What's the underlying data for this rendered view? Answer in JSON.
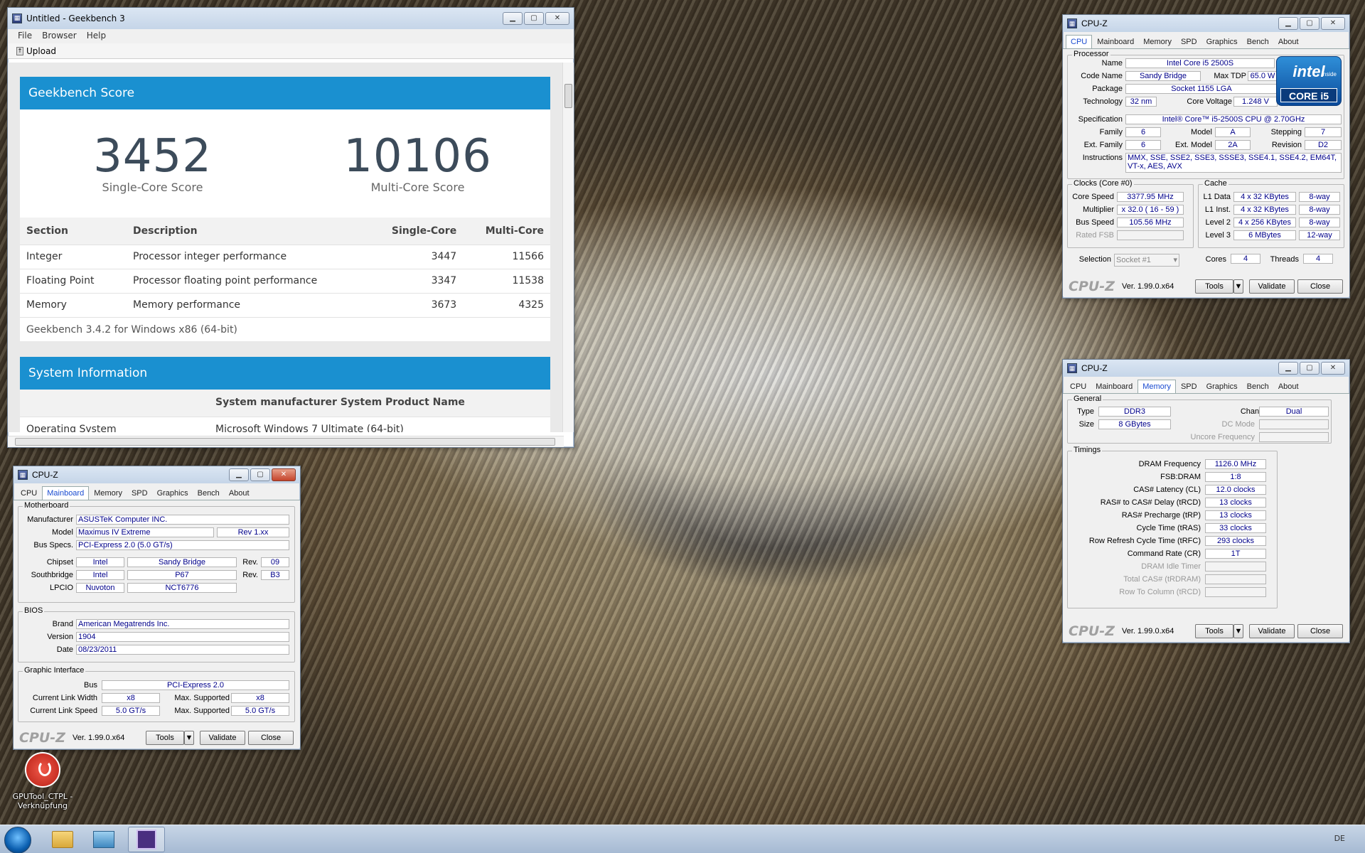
{
  "geekbench": {
    "title": "Untitled - Geekbench 3",
    "menu": [
      "File",
      "Browser",
      "Help"
    ],
    "toolbar_upload": "Upload",
    "score_header": "Geekbench Score",
    "single_score": "3452",
    "single_label": "Single-Core Score",
    "multi_score": "10106",
    "multi_label": "Multi-Core Score",
    "columns": [
      "Section",
      "Description",
      "Single-Core",
      "Multi-Core"
    ],
    "rows": [
      [
        "Integer",
        "Processor integer performance",
        "3447",
        "11566"
      ],
      [
        "Floating Point",
        "Processor floating point performance",
        "3347",
        "11538"
      ],
      [
        "Memory",
        "Memory performance",
        "3673",
        "4325"
      ]
    ],
    "footer": "Geekbench 3.4.2 for Windows x86 (64-bit)",
    "sysinfo_header": "System Information",
    "sysinfo_col": "System manufacturer System Product Name",
    "sysinfo_row": [
      "Operating System",
      "Microsoft Windows 7 Ultimate (64-bit)"
    ]
  },
  "cpuz_common": {
    "title": "CPU-Z",
    "tabs": [
      "CPU",
      "Mainboard",
      "Memory",
      "SPD",
      "Graphics",
      "Bench",
      "About"
    ],
    "logo": "CPU-Z",
    "version": "Ver. 1.99.0.x64",
    "tools": "Tools",
    "validate": "Validate",
    "close": "Close",
    "tools_arrow": "▼"
  },
  "cpuz_cpu": {
    "group_processor": "Processor",
    "name_l": "Name",
    "name": "Intel Core i5 2500S",
    "codename_l": "Code Name",
    "codename": "Sandy Bridge",
    "maxtdp_l": "Max TDP",
    "maxtdp": "65.0 W",
    "package_l": "Package",
    "package": "Socket 1155 LGA",
    "tech_l": "Technology",
    "tech": "32 nm",
    "cvolt_l": "Core Voltage",
    "cvolt": "1.248 V",
    "spec_l": "Specification",
    "spec": "Intel® Core™ i5-2500S CPU @ 2.70GHz",
    "family_l": "Family",
    "family": "6",
    "model_l": "Model",
    "model": "A",
    "stepping_l": "Stepping",
    "stepping": "7",
    "extfam_l": "Ext. Family",
    "extfam": "6",
    "extmodel_l": "Ext. Model",
    "extmodel": "2A",
    "revision_l": "Revision",
    "revision": "D2",
    "instr_l": "Instructions",
    "instr": "MMX, SSE, SSE2, SSE3, SSSE3, SSE4.1, SSE4.2, EM64T, VT-x, AES, AVX",
    "group_clocks": "Clocks (Core #0)",
    "corespeed_l": "Core Speed",
    "corespeed": "3377.95 MHz",
    "multiplier_l": "Multiplier",
    "multiplier": "x 32.0 ( 16 - 59 )",
    "busspeed_l": "Bus Speed",
    "busspeed": "105.56 MHz",
    "ratedfsb_l": "Rated FSB",
    "group_cache": "Cache",
    "l1d_l": "L1 Data",
    "l1d": "4 x 32 KBytes",
    "l1d_w": "8-way",
    "l1i_l": "L1 Inst.",
    "l1i": "4 x 32 KBytes",
    "l1i_w": "8-way",
    "l2_l": "Level 2",
    "l2": "4 x 256 KBytes",
    "l2_w": "8-way",
    "l3_l": "Level 3",
    "l3": "6 MBytes",
    "l3_w": "12-way",
    "selection_l": "Selection",
    "selection": "Socket #1",
    "cores_l": "Cores",
    "cores": "4",
    "threads_l": "Threads",
    "threads": "4",
    "intel_badge": {
      "brand": "intel",
      "inside": "inside",
      "line": "CORE i5"
    }
  },
  "cpuz_memory": {
    "group_general": "General",
    "type_l": "Type",
    "type": "DDR3",
    "channel_l": "Channel #",
    "channel": "Dual",
    "size_l": "Size",
    "size": "8 GBytes",
    "dcmode_l": "DC Mode",
    "uncore_l": "Uncore Frequency",
    "group_timings": "Timings",
    "timings": [
      [
        "DRAM Frequency",
        "1126.0 MHz"
      ],
      [
        "FSB:DRAM",
        "1:8"
      ],
      [
        "CAS# Latency (CL)",
        "12.0 clocks"
      ],
      [
        "RAS# to CAS# Delay (tRCD)",
        "13 clocks"
      ],
      [
        "RAS# Precharge (tRP)",
        "13 clocks"
      ],
      [
        "Cycle Time (tRAS)",
        "33 clocks"
      ],
      [
        "Row Refresh Cycle Time (tRFC)",
        "293 clocks"
      ],
      [
        "Command Rate (CR)",
        "1T"
      ],
      [
        "DRAM Idle Timer",
        ""
      ],
      [
        "Total CAS# (tRDRAM)",
        ""
      ],
      [
        "Row To Column (tRCD)",
        ""
      ]
    ]
  },
  "cpuz_mainboard": {
    "group_mb": "Motherboard",
    "manuf_l": "Manufacturer",
    "manuf": "ASUSTeK Computer INC.",
    "model_l": "Model",
    "model": "Maximus IV Extreme",
    "rev": "Rev 1.xx",
    "busspec_l": "Bus Specs.",
    "busspec": "PCI-Express 2.0 (5.0 GT/s)",
    "chipset_l": "Chipset",
    "chipset_v": "Intel",
    "chipset_n": "Sandy Bridge",
    "chipset_rev_l": "Rev.",
    "chipset_rev": "09",
    "south_l": "Southbridge",
    "south_v": "Intel",
    "south_n": "P67",
    "south_rev_l": "Rev.",
    "south_rev": "B3",
    "lpcio_l": "LPCIO",
    "lpcio_v": "Nuvoton",
    "lpcio_n": "NCT6776",
    "group_bios": "BIOS",
    "brand_l": "Brand",
    "brand": "American Megatrends Inc.",
    "version_l": "Version",
    "version": "1904",
    "date_l": "Date",
    "date": "08/23/2011",
    "group_gi": "Graphic Interface",
    "bus_l": "Bus",
    "bus": "PCI-Express 2.0",
    "clw_l": "Current Link Width",
    "clw": "x8",
    "msw_l": "Max. Supported",
    "msw": "x8",
    "cls_l": "Current Link Speed",
    "cls": "5.0 GT/s",
    "mss_l": "Max. Supported",
    "mss": "5.0 GT/s"
  },
  "desktop": {
    "icon_label": "GPUTool_CTPL - Verknüpfung"
  },
  "taskbar": {
    "tray_lang": "DE"
  }
}
